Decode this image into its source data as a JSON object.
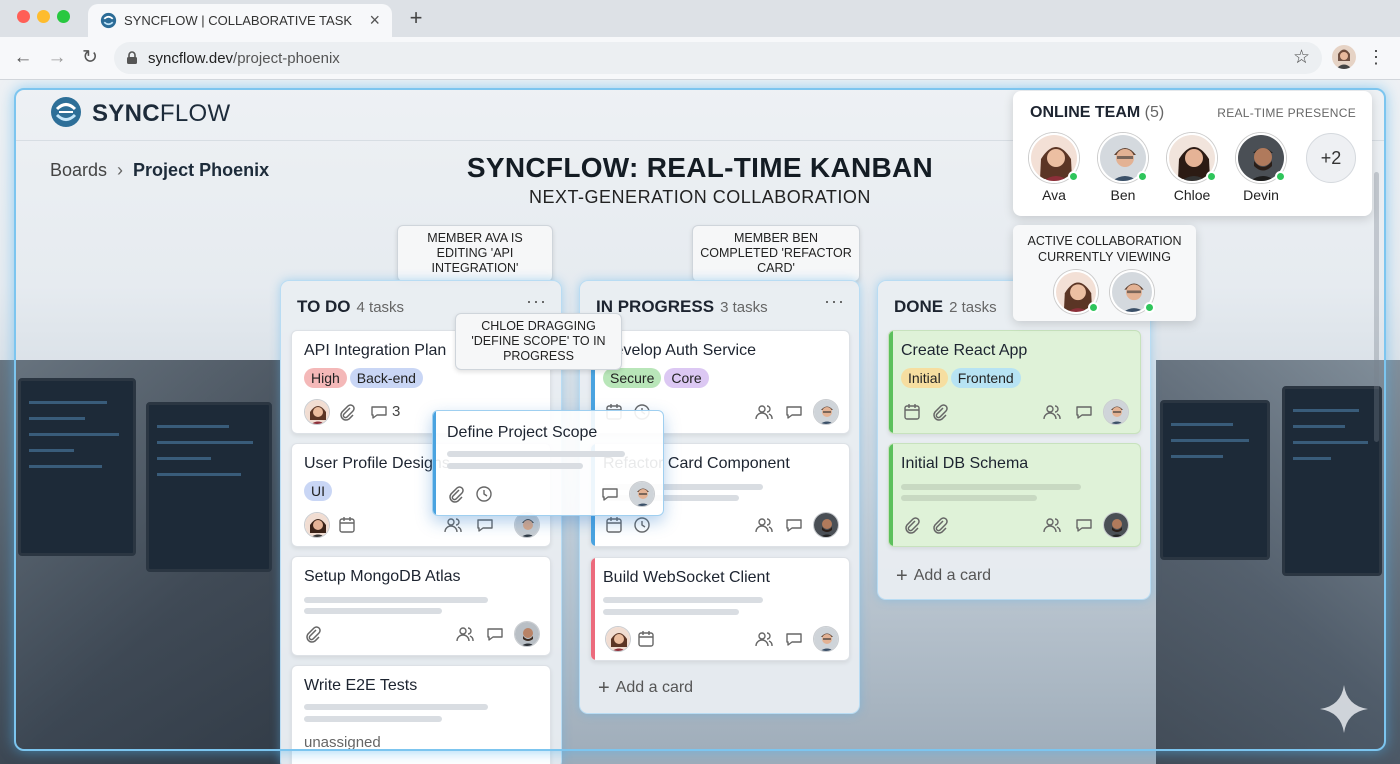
{
  "browser": {
    "tab_title": "SYNCFLOW | COLLABORATIVE TASK BOARD",
    "tab_close": "×",
    "new_tab": "+",
    "url_domain": "syncflow.dev",
    "url_path": "/project-phoenix",
    "back": "←",
    "forward": "→",
    "reload": "↻",
    "star": "☆",
    "menu": "⋮"
  },
  "app": {
    "logo_bold": "SYNC",
    "logo_light": "FLOW",
    "breadcrumb_root": "Boards",
    "breadcrumb_sep": "›",
    "breadcrumb_current": "Project Phoenix",
    "title": "SYNCFLOW: REAL-TIME KANBAN",
    "subtitle": "NEXT-GENERATION COLLABORATION"
  },
  "callouts": {
    "ava_editing": "MEMBER AVA IS EDITING 'API INTEGRATION'",
    "ben_completed": "MEMBER BEN COMPLETED 'REFACTOR CARD'",
    "chloe_dragging": "CHLOE DRAGGING 'DEFINE SCOPE' TO IN PROGRESS"
  },
  "team": {
    "title": "ONLINE TEAM",
    "count": "(5)",
    "presence_label": "REAL-TIME PRESENCE",
    "members": [
      {
        "name": "Ava"
      },
      {
        "name": "Ben"
      },
      {
        "name": "Chloe"
      },
      {
        "name": "Devin"
      }
    ],
    "more": "+2",
    "collab_line1": "ACTIVE COLLABORATION",
    "collab_line2": "CURRENTLY VIEWING"
  },
  "columns": [
    {
      "title": "TO DO",
      "count": "4 tasks",
      "menu": "···",
      "cards": [
        {
          "title": "API Integration Plan",
          "tags": [
            "High",
            "Back-end"
          ],
          "comments": "3"
        },
        {
          "title": "User Profile Designs",
          "tags": [
            "UI"
          ]
        },
        {
          "title": "Setup MongoDB Atlas"
        },
        {
          "title": "Write E2E Tests",
          "footer": "unassigned"
        }
      ]
    },
    {
      "title": "IN PROGRESS",
      "count": "3 tasks",
      "menu": "···",
      "cards": [
        {
          "title": "Develop Auth Service",
          "tags": [
            "Secure",
            "Core"
          ]
        },
        {
          "title": "Refactor Card Component"
        },
        {
          "title": "Build WebSocket Client"
        }
      ],
      "add_card": "Add a card"
    },
    {
      "title": "DONE",
      "count": "2 tasks",
      "cards": [
        {
          "title": "Create React App",
          "tags": [
            "Initial",
            "Frontend"
          ]
        },
        {
          "title": "Initial DB Schema"
        }
      ],
      "add_card": "Add a card"
    }
  ],
  "drag_card": {
    "title": "Define Project Scope"
  },
  "colors": {
    "tag_high": "#f4b8b8",
    "tag_backend": "#c9d6f5",
    "tag_ui": "#c9d6f5",
    "tag_secure": "#b9e6b9",
    "tag_core": "#dcc8f3",
    "tag_initial": "#f6dea0",
    "tag_frontend": "#b7e3f3",
    "accent_blue": "#4aa3e0",
    "accent_red": "#ec6b7d",
    "accent_green": "#5cc05c",
    "online": "#2fc55b"
  }
}
